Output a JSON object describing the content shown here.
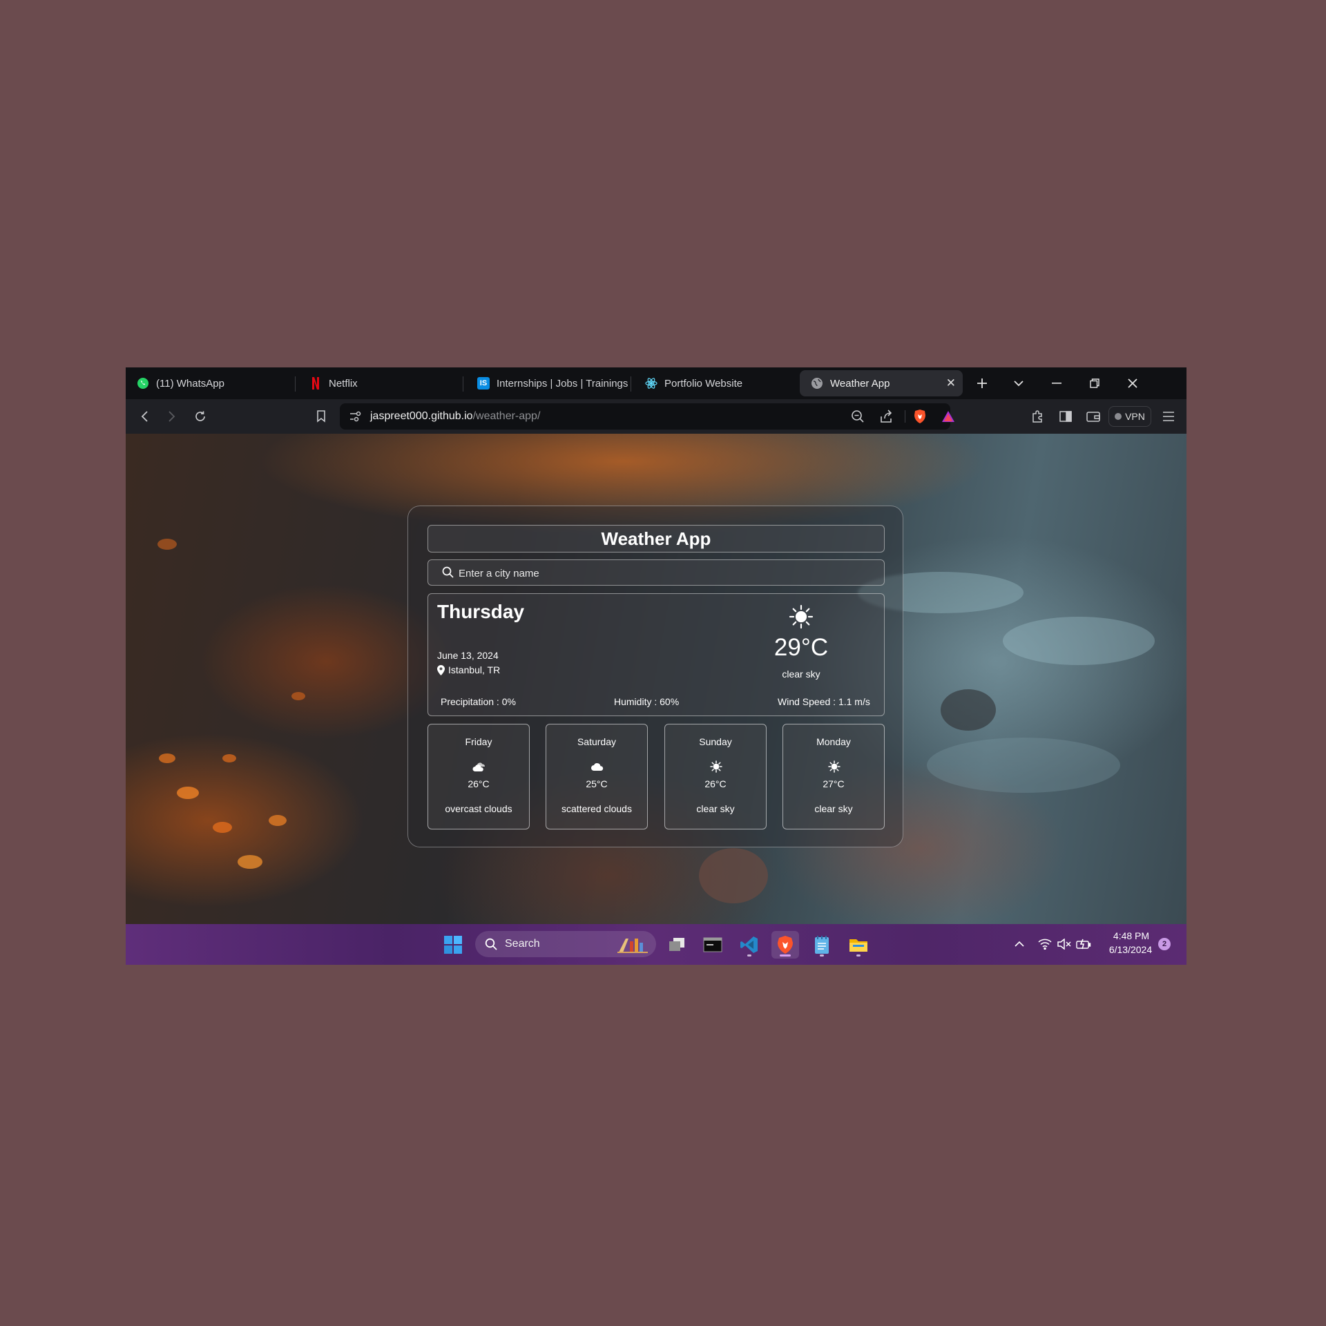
{
  "browser": {
    "tabs": [
      {
        "label": "(11) WhatsApp",
        "icon": "whatsapp-icon"
      },
      {
        "label": "Netflix",
        "icon": "netflix-icon"
      },
      {
        "label": "Internships | Jobs | Trainings &",
        "icon": "internshala-icon"
      },
      {
        "label": "Portfolio Website",
        "icon": "react-icon"
      },
      {
        "label": "Weather App",
        "icon": "globe-icon",
        "active": true
      }
    ],
    "url_host": "jaspreet000.github.io",
    "url_path": "/weather-app/",
    "vpn_label": "VPN"
  },
  "app": {
    "title": "Weather App",
    "search_placeholder": "Enter a city name",
    "today": {
      "day": "Thursday",
      "date": "June 13, 2024",
      "location": "Istanbul, TR",
      "temp": "29°C",
      "description": "clear sky",
      "icon": "sun-icon",
      "precipitation": "Precipitation : 0%",
      "humidity": "Humidity : 60%",
      "wind": "Wind Speed : 1.1 m/s"
    },
    "forecast": [
      {
        "day": "Friday",
        "temp": "26°C",
        "description": "overcast clouds",
        "icon": "overcast-clouds-icon"
      },
      {
        "day": "Saturday",
        "temp": "25°C",
        "description": "scattered clouds",
        "icon": "cloud-icon"
      },
      {
        "day": "Sunday",
        "temp": "26°C",
        "description": "clear sky",
        "icon": "sun-icon"
      },
      {
        "day": "Monday",
        "temp": "27°C",
        "description": "clear sky",
        "icon": "sun-icon"
      }
    ]
  },
  "taskbar": {
    "search_label": "Search",
    "time": "4:48 PM",
    "date": "6/13/2024",
    "notifications": "2"
  },
  "colors": {
    "desktop_background": "#6b4b4e",
    "taskbar": "#5a2a72",
    "brave_accent": "#fb542b"
  }
}
